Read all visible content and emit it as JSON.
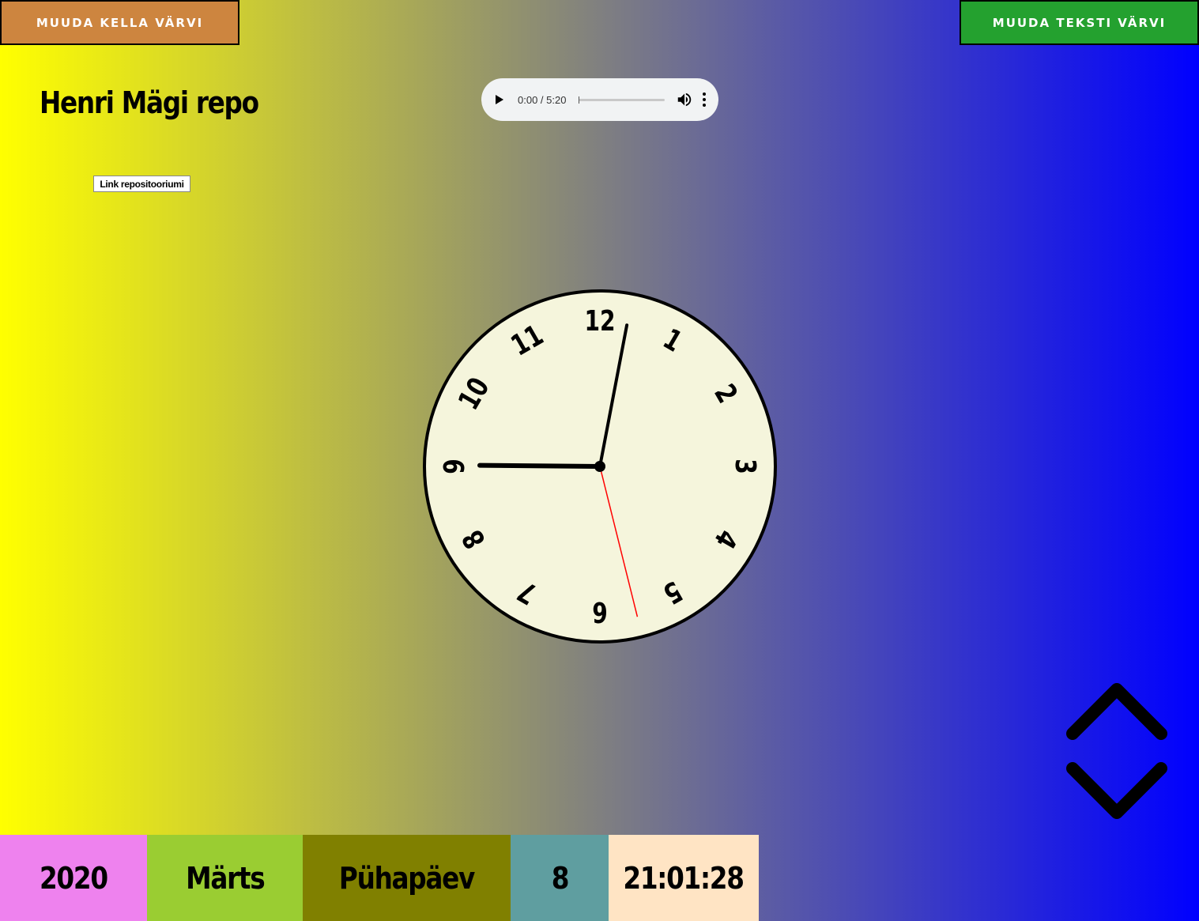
{
  "buttons": {
    "clock_color": "MUUDA KELLA VÄRVI",
    "text_color": "MUUDA TEKSTI VÄRVI"
  },
  "heading": "Henri Mägi repo",
  "repo_link": "Link repositooriumi",
  "audio": {
    "time": "0:00 / 5:20",
    "progress": 0
  },
  "clock": {
    "face_color": "#f5f5dc",
    "numbers": [
      "12",
      "1",
      "2",
      "3",
      "4",
      "5",
      "6",
      "7",
      "8",
      "9",
      "10",
      "11"
    ],
    "hours": 21,
    "minutes": 1,
    "seconds": 28,
    "second_hand_color": "#ff0000"
  },
  "date_bar": {
    "year": "2020",
    "month": "Märts",
    "weekday": "Pühapäev",
    "day": "8",
    "time": "21:01:28",
    "colors": [
      "#ee82ee",
      "#9acd32",
      "#808000",
      "#5f9ea0",
      "#ffe4c4"
    ]
  },
  "icons": {
    "play": "play-icon",
    "volume": "volume-icon",
    "menu": "more-vert-icon",
    "scroll_up": "chevron-up-icon",
    "scroll_down": "chevron-down-icon"
  },
  "colors": {
    "gradient_start": "#ffff00",
    "gradient_mid": "#808080",
    "gradient_end": "#0000ff",
    "clock_button": "#cd853f",
    "text_button": "#24a12f"
  }
}
